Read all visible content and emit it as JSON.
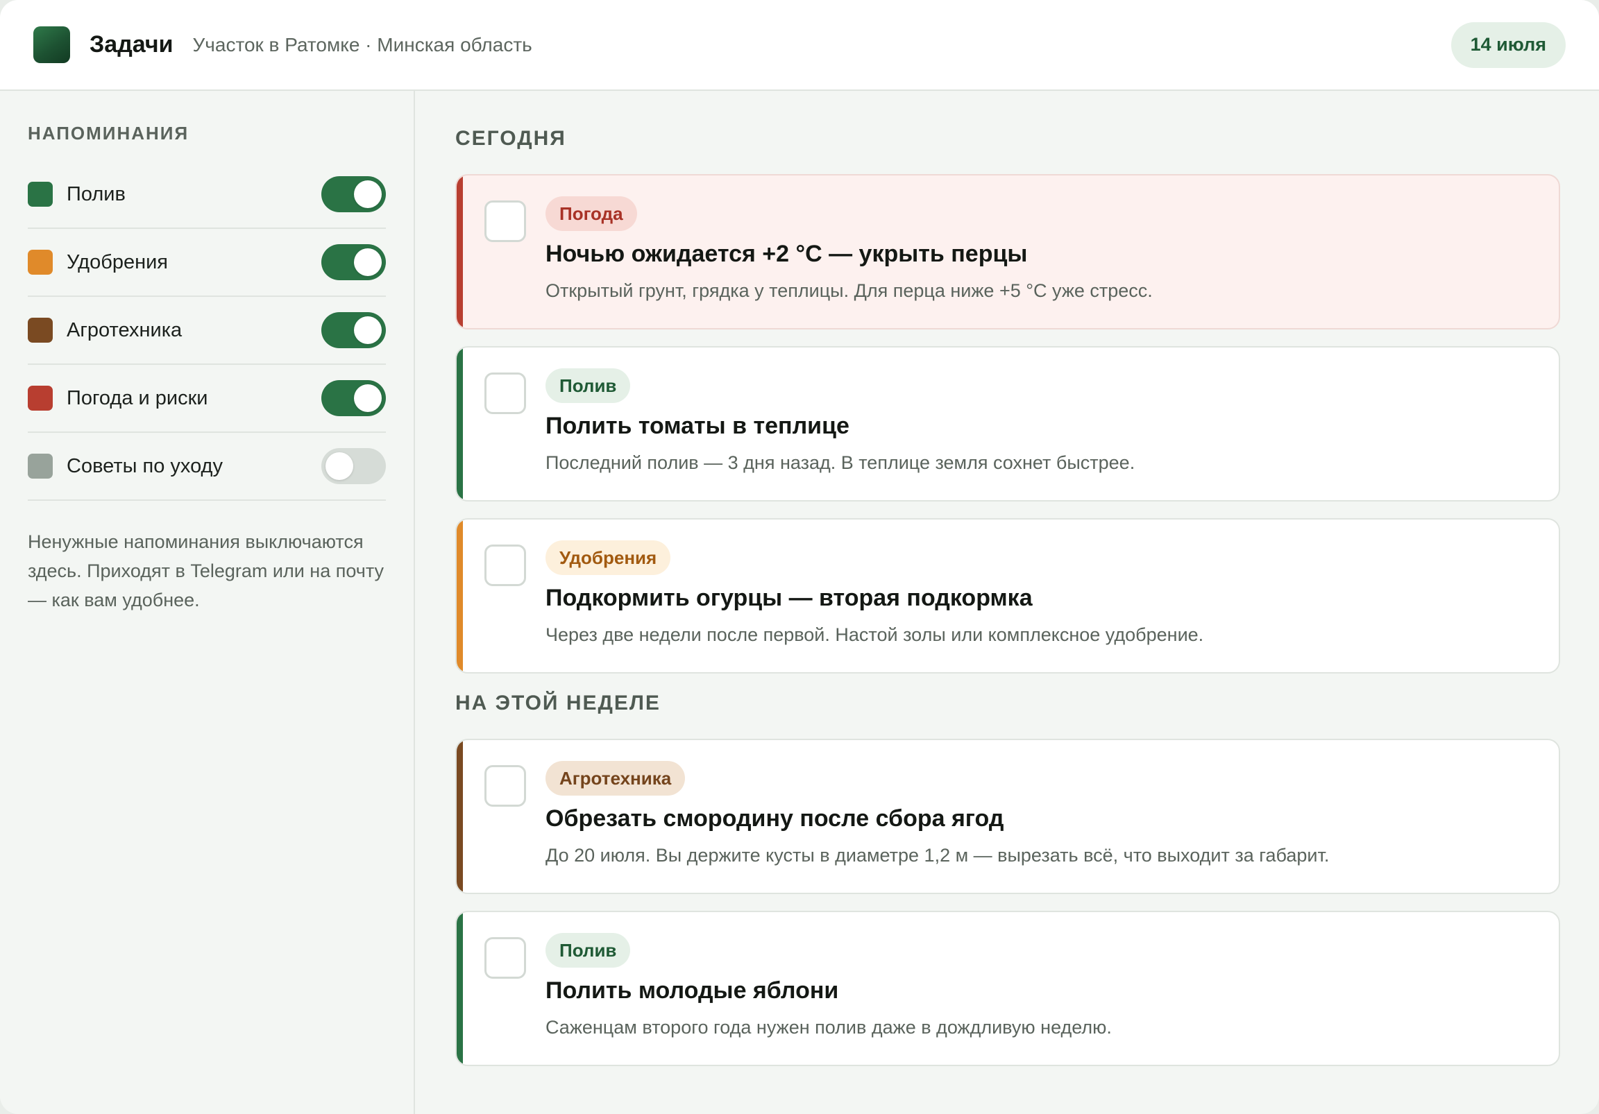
{
  "header": {
    "title": "Задачи",
    "subtitle": "Участок в Ратомке · Минская область",
    "date": "14 июля"
  },
  "sidebar": {
    "heading": "НАПОМИНАНИЯ",
    "toggles": [
      {
        "label": "Полив",
        "color": "#2a7345",
        "enabled": true
      },
      {
        "label": "Удобрения",
        "color": "#e08a2a",
        "enabled": true
      },
      {
        "label": "Агротехника",
        "color": "#7a4a22",
        "enabled": true
      },
      {
        "label": "Погода и риски",
        "color": "#b83e30",
        "enabled": true
      },
      {
        "label": "Советы по уходу",
        "color": "#98a39b",
        "enabled": false
      }
    ],
    "note": "Ненужные напоминания выключаются здесь. Приходят в Telegram или на почту — как вам удобнее."
  },
  "main": {
    "sections": [
      {
        "title": "СЕГОДНЯ",
        "tasks": [
          {
            "tag": "Погода",
            "title": "Ночью ожидается +2 °C — укрыть перцы",
            "desc": "Открытый грунт, грядка у теплицы. Для перца ниже +5 °C уже стресс.",
            "accent": "#b83e30",
            "tag_bg": "#f7d9d4",
            "tag_fg": "#a83226",
            "alert": true,
            "checked": false
          },
          {
            "tag": "Полив",
            "title": "Полить томаты в теплице",
            "desc": "Последний полив — 3 дня назад. В теплице земля сохнет быстрее.",
            "accent": "#2a7345",
            "tag_bg": "#e5f0e7",
            "tag_fg": "#1f5a35",
            "alert": false,
            "checked": false
          },
          {
            "tag": "Удобрения",
            "title": "Подкормить огурцы — вторая подкормка",
            "desc": "Через две недели после первой. Настой золы или комплексное удобрение.",
            "accent": "#e08a2a",
            "tag_bg": "#fdf0dc",
            "tag_fg": "#a25a10",
            "alert": false,
            "checked": false
          }
        ]
      },
      {
        "title": "НА ЭТОЙ НЕДЕЛЕ",
        "tasks": [
          {
            "tag": "Агротехника",
            "title": "Обрезать смородину после сбора ягод",
            "desc": "До 20 июля. Вы держите кусты в диаметре 1,2 м — вырезать всё, что выходит за габарит.",
            "accent": "#7a4a22",
            "tag_bg": "#f2e3d3",
            "tag_fg": "#74441c",
            "alert": false,
            "checked": false
          },
          {
            "tag": "Полив",
            "title": "Полить молодые яблони",
            "desc": "Саженцам второго года нужен полив даже в дождливую неделю.",
            "accent": "#2a7345",
            "tag_bg": "#e5f0e7",
            "tag_fg": "#1f5a35",
            "alert": false,
            "checked": false
          }
        ]
      }
    ]
  }
}
